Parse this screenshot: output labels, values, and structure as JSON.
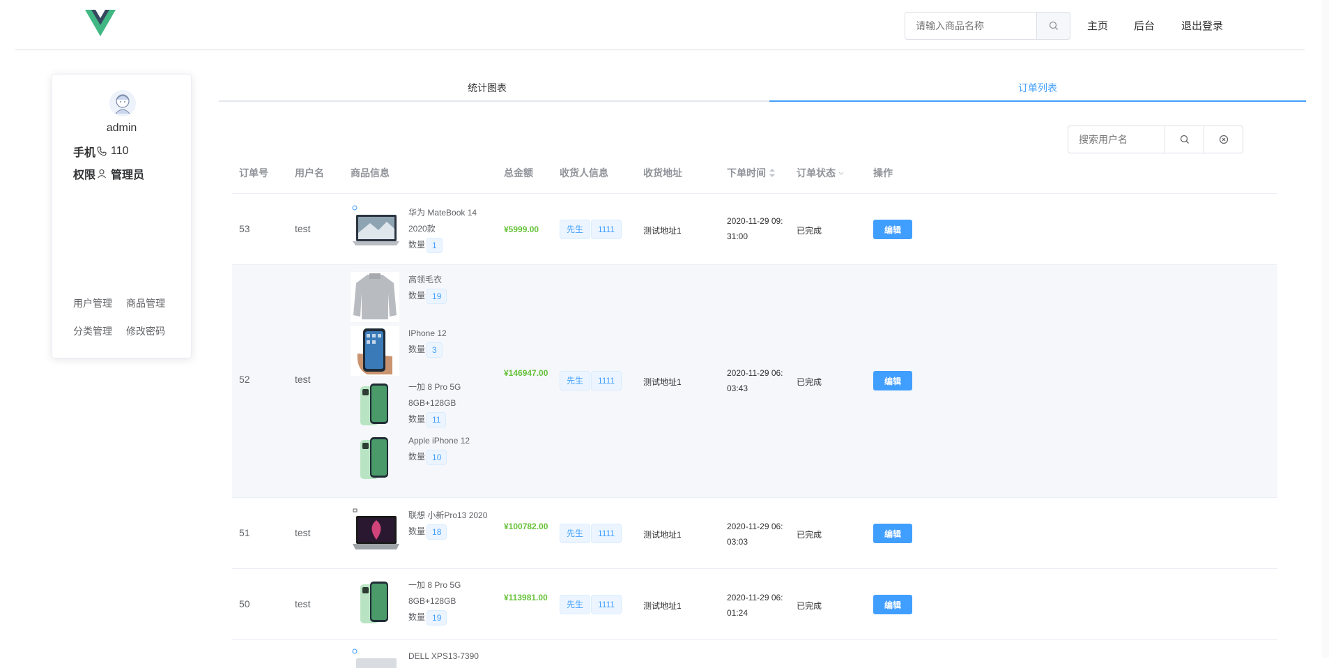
{
  "header": {
    "search_placeholder": "请输入商品名称",
    "nav": {
      "home": "主页",
      "admin": "后台",
      "logout": "退出登录"
    }
  },
  "profile": {
    "username": "admin",
    "phone_label": "手机",
    "phone_value": "110",
    "role_label": "权限",
    "role_value": "管理员",
    "links": [
      "用户管理",
      "商品管理",
      "分类管理",
      "修改密码"
    ]
  },
  "tabs": [
    "统计图表",
    "订单列表"
  ],
  "table_toolbar": {
    "search_placeholder": "搜索用户名"
  },
  "table": {
    "headers": [
      "订单号",
      "用户名",
      "商品信息",
      "总金额",
      "收货人信息",
      "收货地址",
      "下单时间",
      "订单状态",
      "操作"
    ],
    "qty_label": "数量",
    "edit_label": "编辑",
    "rows": [
      {
        "id": "53",
        "user": "test",
        "total": "¥5999.00",
        "recv_name": "先生",
        "recv_phone": "1111",
        "address": "测试地址1",
        "time": "2020-11-29 09:31:00",
        "status": "已完成",
        "items": [
          {
            "name": "华为 MateBook 14 2020款",
            "qty": "1",
            "img": "laptop-grey"
          }
        ]
      },
      {
        "id": "52",
        "user": "test",
        "total": "¥146947.00",
        "recv_name": "先生",
        "recv_phone": "1111",
        "address": "测试地址1",
        "time": "2020-11-29 06:03:43",
        "status": "已完成",
        "items": [
          {
            "name": "高领毛衣",
            "qty": "19",
            "img": "sweater"
          },
          {
            "name": "IPhone 12",
            "qty": "3",
            "img": "phone-hand"
          },
          {
            "name": "一加 8 Pro 5G 8GB+128GB",
            "qty": "11",
            "img": "phone-green"
          },
          {
            "name": "Apple iPhone 12",
            "qty": "10",
            "img": "phone-green"
          }
        ]
      },
      {
        "id": "51",
        "user": "test",
        "total": "¥100782.00",
        "recv_name": "先生",
        "recv_phone": "1111",
        "address": "测试地址1",
        "time": "2020-11-29 06:03:03",
        "status": "已完成",
        "items": [
          {
            "name": "联想 小新Pro13 2020",
            "qty": "18",
            "img": "laptop-dark"
          }
        ]
      },
      {
        "id": "50",
        "user": "test",
        "total": "¥113981.00",
        "recv_name": "先生",
        "recv_phone": "1111",
        "address": "测试地址1",
        "time": "2020-11-29 06:01:24",
        "status": "已完成",
        "items": [
          {
            "name": "一加 8 Pro 5G 8GB+128GB",
            "qty": "19",
            "img": "phone-green"
          }
        ]
      },
      {
        "id": "",
        "user": "",
        "total": "",
        "items": [
          {
            "name": "DELL XPS13-7390",
            "qty": "",
            "img": "laptop-grey"
          }
        ]
      }
    ]
  },
  "colors": {
    "primary": "#409eff",
    "success": "#67c23a",
    "vue_green": "#41b883",
    "vue_dark": "#35495e"
  }
}
